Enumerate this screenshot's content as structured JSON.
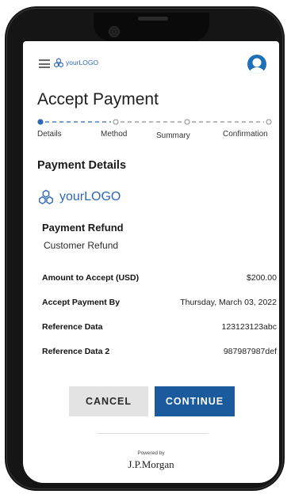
{
  "app": {
    "title": "Accept Payment"
  },
  "header": {
    "logo": {
      "prefix": "your",
      "suffix": "LOGO",
      "icon": "logo-hexagons-icon"
    },
    "menu_icon": "hamburger-menu-icon",
    "avatar_icon": "user-avatar-icon",
    "accent_color": "#2f66b5"
  },
  "stepper": {
    "steps": [
      "Details",
      "Method",
      "Summary",
      "Confirmation"
    ],
    "current_index": 0,
    "active_color": "#2f66b5",
    "inactive_color": "#8a8a8a"
  },
  "section": {
    "title": "Payment Details",
    "logo": {
      "prefix": "your",
      "suffix": "LOGO"
    }
  },
  "refund": {
    "title": "Payment Refund",
    "subtitle": "Customer Refund"
  },
  "details": [
    {
      "label": "Amount to Accept (USD)",
      "value": "$200.00"
    },
    {
      "label": "Accept Payment By",
      "value": "Thursday, March 03, 2022"
    },
    {
      "label": "Reference Data",
      "value": "123123123abc"
    },
    {
      "label": "Reference Data 2",
      "value": "987987987def"
    }
  ],
  "actions": {
    "cancel_label": "CANCEL",
    "continue_label": "CONTINUE",
    "primary_color": "#1c5a9e"
  },
  "footer": {
    "powered_by": "Powered by",
    "brand": "J.P.Morgan"
  }
}
